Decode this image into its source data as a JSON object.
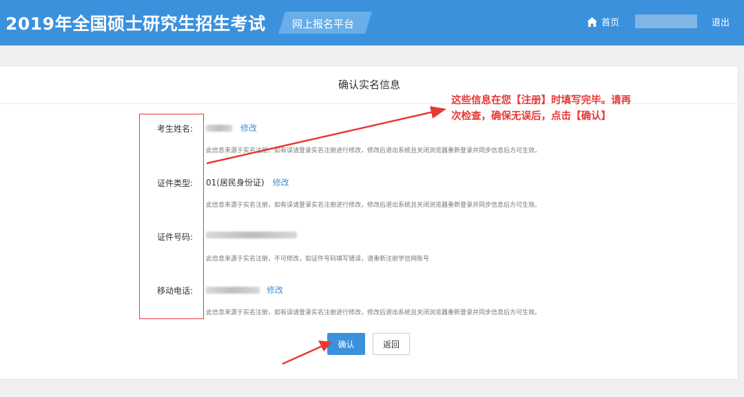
{
  "header": {
    "title": "2019年全国硕士研究生招生考试",
    "platform_tab": "网上报名平台",
    "home_label": "首页",
    "logout_label": "退出"
  },
  "card": {
    "title": "确认实名信息"
  },
  "fields": [
    {
      "label": "考生姓名:",
      "value": "",
      "edit": "修改",
      "hint": "此信息来源于实名注册，如有误请登录实名注册进行修改，修改后退出系统且关闭浏览器重新登录并同步信息后方可生效。"
    },
    {
      "label": "证件类型:",
      "value": "01(居民身份证)",
      "edit": "修改",
      "hint": "此信息来源于实名注册，如有误请登录实名注册进行修改，修改后退出系统且关闭浏览器重新登录并同步信息后方可生效。"
    },
    {
      "label": "证件号码:",
      "value": "",
      "edit": "",
      "hint": "此信息来源于实名注册，不可修改，如证件号码填写错误，请重新注册学信网账号"
    },
    {
      "label": "移动电话:",
      "value": "",
      "edit": "修改",
      "hint": "此信息来源于实名注册，如有误请登录实名注册进行修改，修改后退出系统且关闭浏览器重新登录并同步信息后方可生效。"
    }
  ],
  "buttons": {
    "confirm": "确认",
    "back": "返回"
  },
  "annotation": {
    "text": "这些信息在您【注册】时填写完毕。请再次检查，确保无误后，点击【确认】"
  },
  "colors": {
    "header_bg": "#3c91dc",
    "annotation": "#e53935",
    "link": "#3c91dc"
  }
}
